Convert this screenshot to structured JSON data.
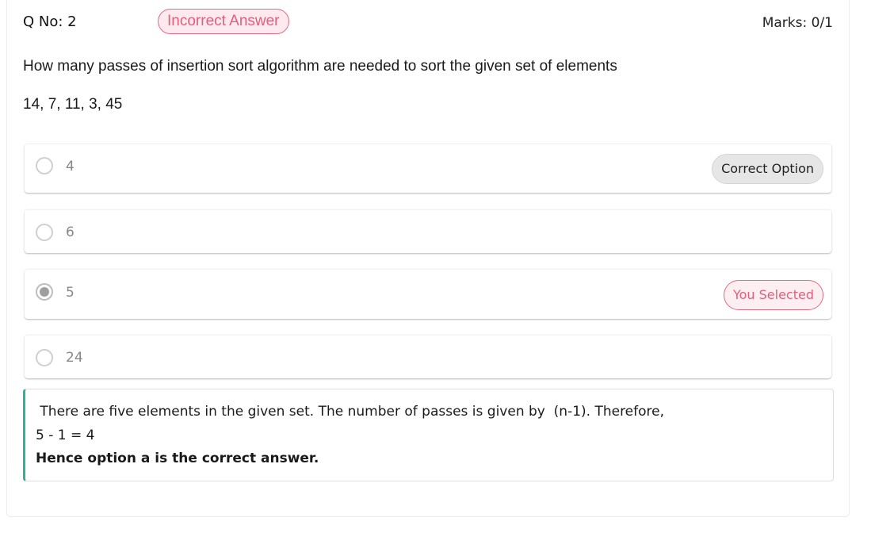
{
  "header": {
    "question_number": "Q No: 2",
    "status": "Incorrect Answer",
    "marks": "Marks: 0/1"
  },
  "question": {
    "text": "How many passes of insertion sort algorithm are needed to sort the given set of elements",
    "elements": "14, 7, 11, 3, 45"
  },
  "options": [
    {
      "label": "4",
      "selected": false,
      "tag": "Correct Option"
    },
    {
      "label": "6",
      "selected": false,
      "tag": ""
    },
    {
      "label": "5",
      "selected": true,
      "tag": "You Selected"
    },
    {
      "label": "24",
      "selected": false,
      "tag": ""
    }
  ],
  "explanation": {
    "line1": " There are five elements in the given set. The number of passes is given by  (n-1). Therefore,",
    "line2": "5 - 1 = 4",
    "line3": "Hence option a is the correct answer."
  },
  "colors": {
    "incorrect_accent": "#e0607e",
    "explanation_border": "#2bb39b",
    "correct_pill_bg": "#e6e6e6"
  }
}
